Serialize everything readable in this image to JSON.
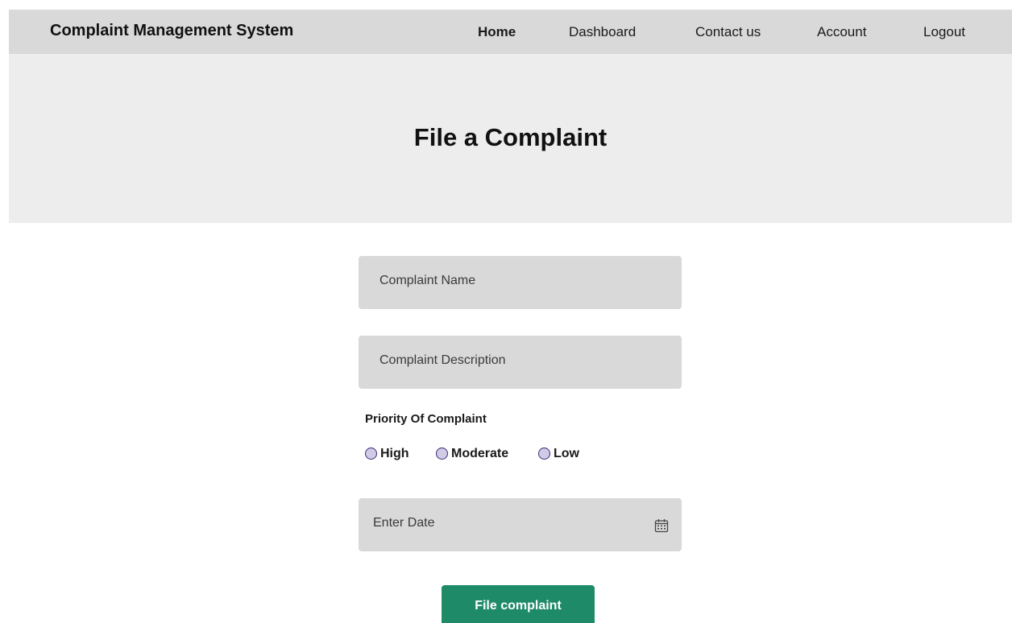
{
  "header": {
    "brand": "Complaint Management System",
    "nav": {
      "home": "Home",
      "dashboard": "Dashboard",
      "contact": "Contact us",
      "account": "Account",
      "logout": "Logout"
    }
  },
  "hero": {
    "title": "File a Complaint"
  },
  "form": {
    "complaint_name": {
      "value": "",
      "placeholder": "Complaint Name"
    },
    "complaint_description": {
      "value": "",
      "placeholder": "Complaint Description"
    },
    "priority": {
      "label": "Priority Of Complaint",
      "options": [
        "High",
        "Moderate",
        "Low"
      ],
      "selected": null
    },
    "date": {
      "value": "",
      "placeholder": "Enter Date",
      "icon": "calendar-icon"
    },
    "submit_label": "File complaint"
  },
  "colors": {
    "nav_background": "#d9d9d9",
    "hero_background": "#ededed",
    "field_background": "#d9d9d9",
    "radio_border": "#3b2a7a",
    "radio_fill": "#d2cbe5",
    "button_background": "#1e8a68",
    "button_text": "#ffffff"
  }
}
